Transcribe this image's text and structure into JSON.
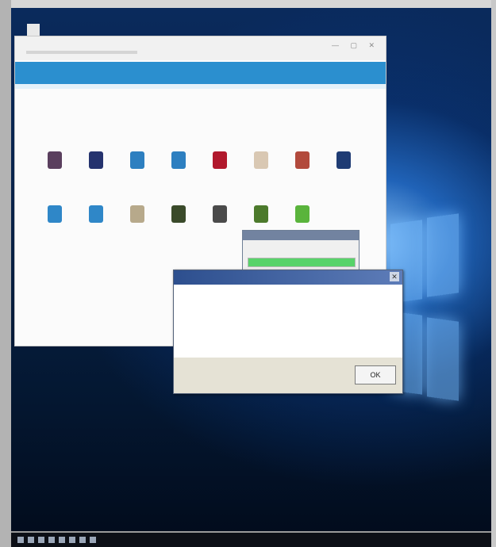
{
  "desktop": {
    "taskbar_icons": [
      "start-icon",
      "search-icon",
      "task-view-icon",
      "explorer-icon",
      "browser-icon",
      "store-icon",
      "mail-icon",
      "app-icon"
    ],
    "clock": ""
  },
  "app": {
    "brand": "",
    "header_links": [
      "",
      ""
    ],
    "status_link": "",
    "tiles": [
      {
        "label": "",
        "color": "#5a3f5e"
      },
      {
        "label": "",
        "color": "#25336e"
      },
      {
        "label": "",
        "color": "#2d7fc0"
      },
      {
        "label": "",
        "color": "#2d7fc0"
      },
      {
        "label": "",
        "color": "#b1182c"
      },
      {
        "label": "",
        "color": "#d9c8b3"
      },
      {
        "label": "",
        "color": "#b24a3c"
      },
      {
        "label": "",
        "color": "#1f3c74"
      },
      {
        "label": "",
        "color": "#2f87c8"
      },
      {
        "label": "",
        "color": "#2f87c8"
      },
      {
        "label": "",
        "color": "#b7a98b"
      },
      {
        "label": "",
        "color": "#3a4a2a"
      },
      {
        "label": "",
        "color": "#4a4a4a"
      },
      {
        "label": "",
        "color": "#4c7a2c"
      },
      {
        "label": "",
        "color": "#5ab43c"
      }
    ]
  },
  "progress_popup": {
    "title": "",
    "text": "",
    "progress": 1.0
  },
  "dialog": {
    "title": "",
    "message": "",
    "ok_label": "OK"
  },
  "colors": {
    "header_blue": "#2b8fcf",
    "progress_green": "#58d36a",
    "dialog_title": "#2d4f8e"
  }
}
